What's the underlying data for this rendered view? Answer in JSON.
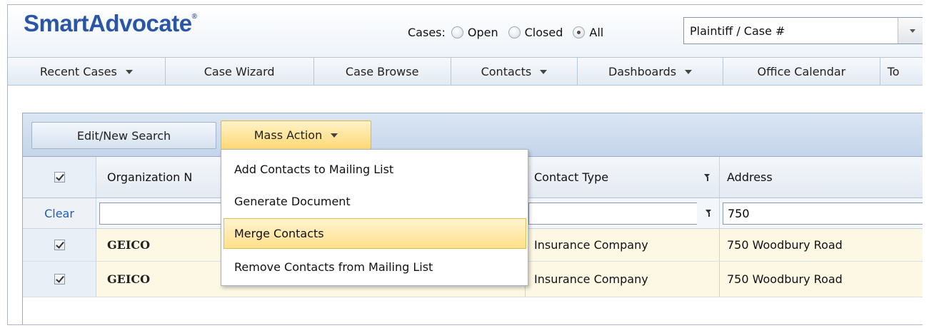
{
  "header": {
    "logo": "SmartAdvocate",
    "logo_mark": "®",
    "cases_label": "Cases:",
    "case_filters": [
      {
        "label": "Open",
        "checked": false
      },
      {
        "label": "Closed",
        "checked": false
      },
      {
        "label": "All",
        "checked": true
      }
    ],
    "search": {
      "value": "Plaintiff / Case #"
    }
  },
  "nav": {
    "items": [
      {
        "label": "Recent Cases",
        "has_caret": true
      },
      {
        "label": "Case Wizard",
        "has_caret": false
      },
      {
        "label": "Case Browse",
        "has_caret": false
      },
      {
        "label": "Contacts",
        "has_caret": true
      },
      {
        "label": "Dashboards",
        "has_caret": true
      },
      {
        "label": "Office Calendar",
        "has_caret": false
      },
      {
        "label": "To",
        "has_caret": false
      }
    ]
  },
  "toolbar": {
    "edit_search_label": "Edit/New Search",
    "mass_action_label": "Mass Action"
  },
  "grid": {
    "columns": [
      "Organization N",
      "Contact Type",
      "Address"
    ],
    "filter": {
      "clear_label": "Clear",
      "organization_value": "",
      "contact_type_value": "",
      "address_value": "750"
    },
    "rows": [
      {
        "checked": true,
        "organization": "GEICO",
        "contact_type": "Insurance Company",
        "address": "750 Woodbury Road"
      },
      {
        "checked": true,
        "organization": "GEICO",
        "contact_type": "Insurance Company",
        "address": "750 Woodbury Road"
      }
    ]
  },
  "mass_action_menu": {
    "items": [
      "Add Contacts to Mailing List",
      "Generate Document",
      "Merge Contacts",
      "Remove Contacts from Mailing List"
    ],
    "highlighted_index": 2
  },
  "colors": {
    "brand_blue": "#2a56a8",
    "link_blue": "#1d5fb8",
    "highlight_gold": "#ffe08a",
    "selected_row": "#fdf8e4"
  }
}
